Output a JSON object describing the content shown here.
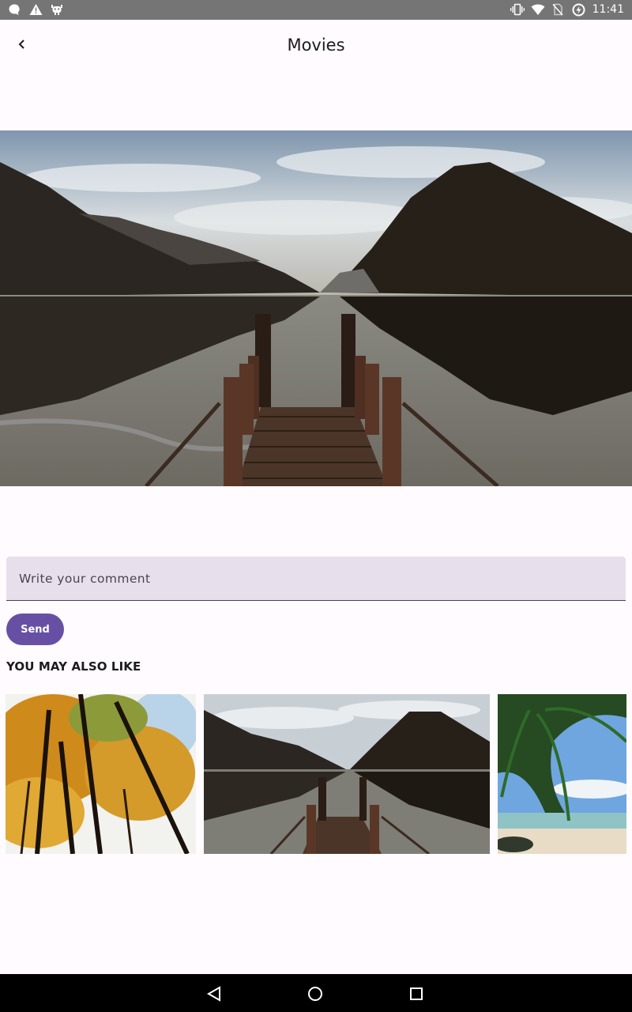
{
  "status_bar": {
    "time": "11:41",
    "left_icons": [
      "chat-bubble-icon",
      "warning-icon",
      "android-debug-icon"
    ],
    "right_icons": [
      "vibrate-icon",
      "wifi-icon",
      "no-sim-icon",
      "battery-charging-icon"
    ]
  },
  "app_bar": {
    "title": "Movies",
    "back_icon": "chevron-left-icon"
  },
  "comment": {
    "placeholder": "Write your comment",
    "value": ""
  },
  "send_label": "Send",
  "recommendations": {
    "title": "YOU MAY ALSO LIKE",
    "items": [
      {
        "image": "autumn-forest"
      },
      {
        "image": "lake-pier"
      },
      {
        "image": "tropical-beach"
      }
    ]
  },
  "nav_bar": {
    "icons": [
      "nav-back-icon",
      "nav-home-icon",
      "nav-recents-icon"
    ]
  },
  "colors": {
    "primary": "#6750a4",
    "background": "#fffbfe",
    "input_fill": "#e7e0ec",
    "status_bar": "#757575",
    "nav_bar": "#000000"
  }
}
